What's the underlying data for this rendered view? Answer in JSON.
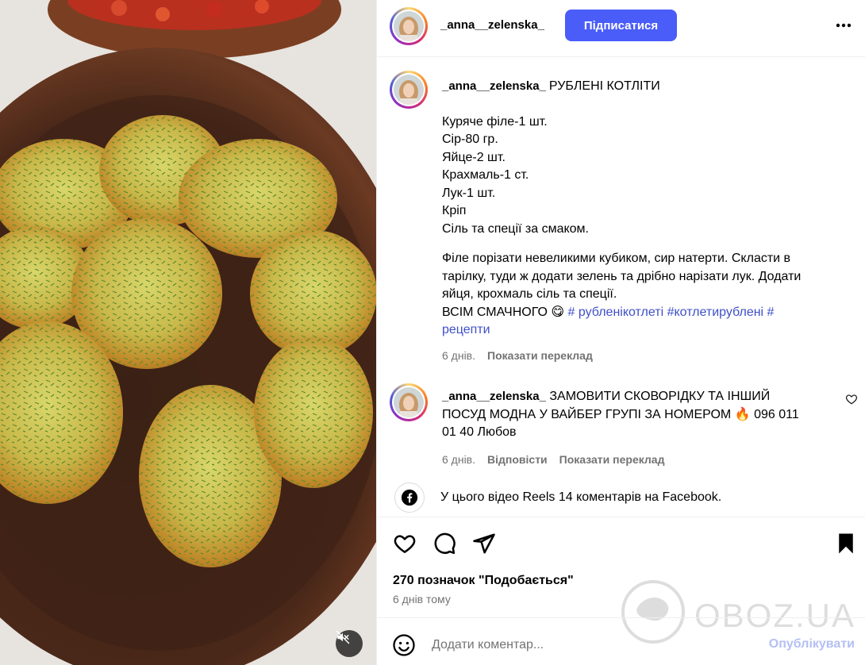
{
  "post": {
    "username": "_anna__zelenska_",
    "follow_label": "Підписатися",
    "menu_icon": "more-icon"
  },
  "caption": {
    "username": "_anna__zelenska_",
    "title": "РУБЛЕНІ КОТЛІТИ",
    "ingredients": [
      "Куряче філе-1 шт.",
      "Сір-80 гр.",
      "Яйце-2 шт.",
      "Крахмаль-1 ст.",
      "Лук-1 шт.",
      "Кріп",
      "Сіль та спеції за смаком."
    ],
    "method": [
      "Філе порізати невеликими кубиком, сир натерти. Скласти в",
      "тарілку, туди ж додати зелень та дрібно нарізати лук. Додати",
      "яйця, крохмаль сіль та спеції."
    ],
    "closing": "ВСІМ СМАЧНОГО",
    "emoji": "😋",
    "hashtags_line1": "# рубленікотлеті #котлетирублені #",
    "hashtags_line2": "рецепти",
    "time": "6 днів.",
    "translate": "Показати переклад"
  },
  "comment": {
    "username": "_anna__zelenska_",
    "text_line1": "ЗАМОВИТИ СКОВОРІДКУ ТА ІНШИЙ",
    "text_line2": "ПОСУД МОДНА У ВАЙБЕР ГРУПІ ЗА НОМЕРОМ",
    "emoji": "🔥",
    "text_line2b": "096 011",
    "text_line3": "01 40 Любов",
    "time": "6 днів.",
    "reply": "Відповісти",
    "translate": "Показати переклад"
  },
  "facebook_note": "У цього відео Reels 14 коментарів на Facebook.",
  "likes": "270 позначок \"Подобається\"",
  "time_ago": "6 днів тому",
  "comment_box": {
    "placeholder": "Додати коментар...",
    "publish": "Опублікувати"
  },
  "watermark": "OBOZ.UA",
  "colors": {
    "follow_button": "#4a5df9",
    "hashtag": "#3f50c8",
    "secondary_text": "#737373",
    "publish_disabled": "#b4bff4"
  }
}
